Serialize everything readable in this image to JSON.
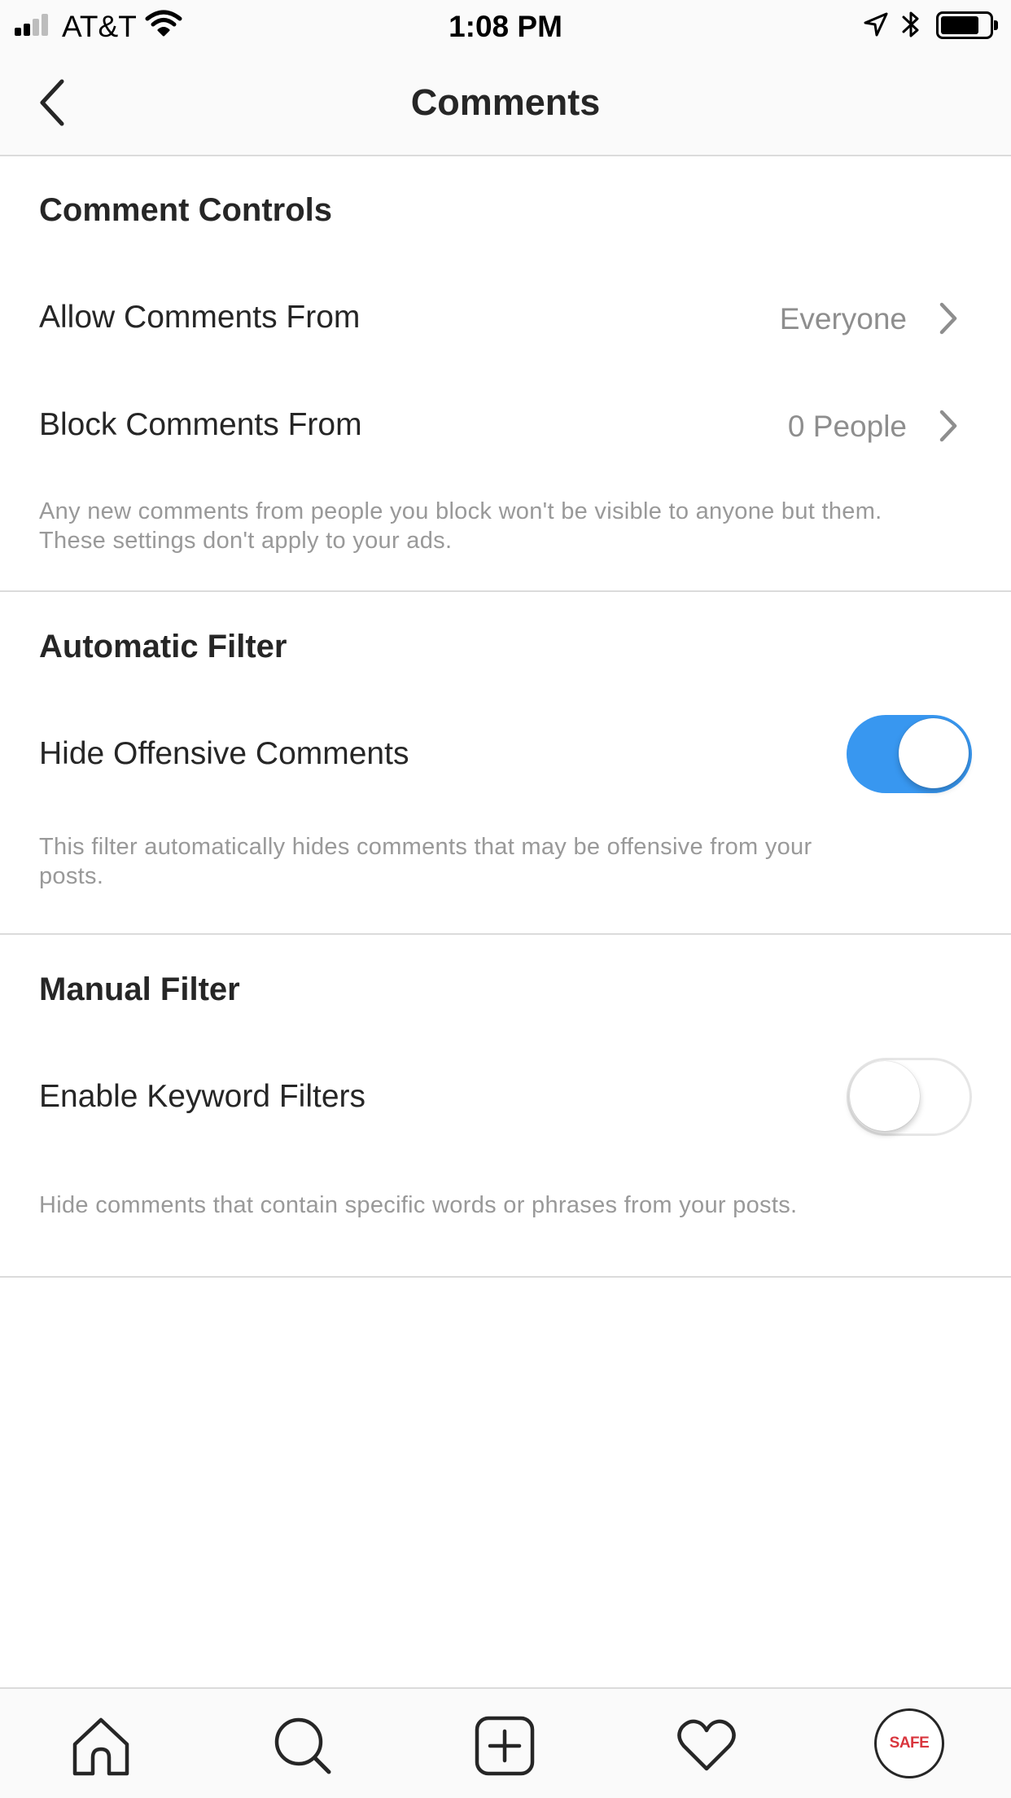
{
  "status_bar": {
    "carrier": "AT&T",
    "time": "1:08 PM"
  },
  "header": {
    "title": "Comments"
  },
  "comment_controls": {
    "title": "Comment Controls",
    "allow_label": "Allow Comments From",
    "allow_value": "Everyone",
    "block_label": "Block Comments From",
    "block_value": "0 People",
    "description_line1": "Any new comments from people you block won't be visible to anyone but them.",
    "description_line2": "These settings don't apply to your ads."
  },
  "automatic_filter": {
    "title": "Automatic Filter",
    "toggle_label": "Hide Offensive Comments",
    "enabled": true,
    "description_line1": "This filter automatically hides comments that may be offensive from your",
    "description_line2": "posts."
  },
  "manual_filter": {
    "title": "Manual Filter",
    "toggle_label": "Enable Keyword Filters",
    "enabled": false,
    "description": "Hide comments that contain specific words or phrases from your posts."
  },
  "tab_bar": {
    "items": [
      "home-icon",
      "search-icon",
      "add-post-icon",
      "heart-icon",
      "profile-avatar"
    ],
    "avatar_text": "SAFE"
  },
  "colors": {
    "accent": "#3897f0",
    "text": "#262626",
    "secondary_text": "#999999",
    "divider": "#dbdbdb",
    "avatar_text": "#d9363e"
  }
}
